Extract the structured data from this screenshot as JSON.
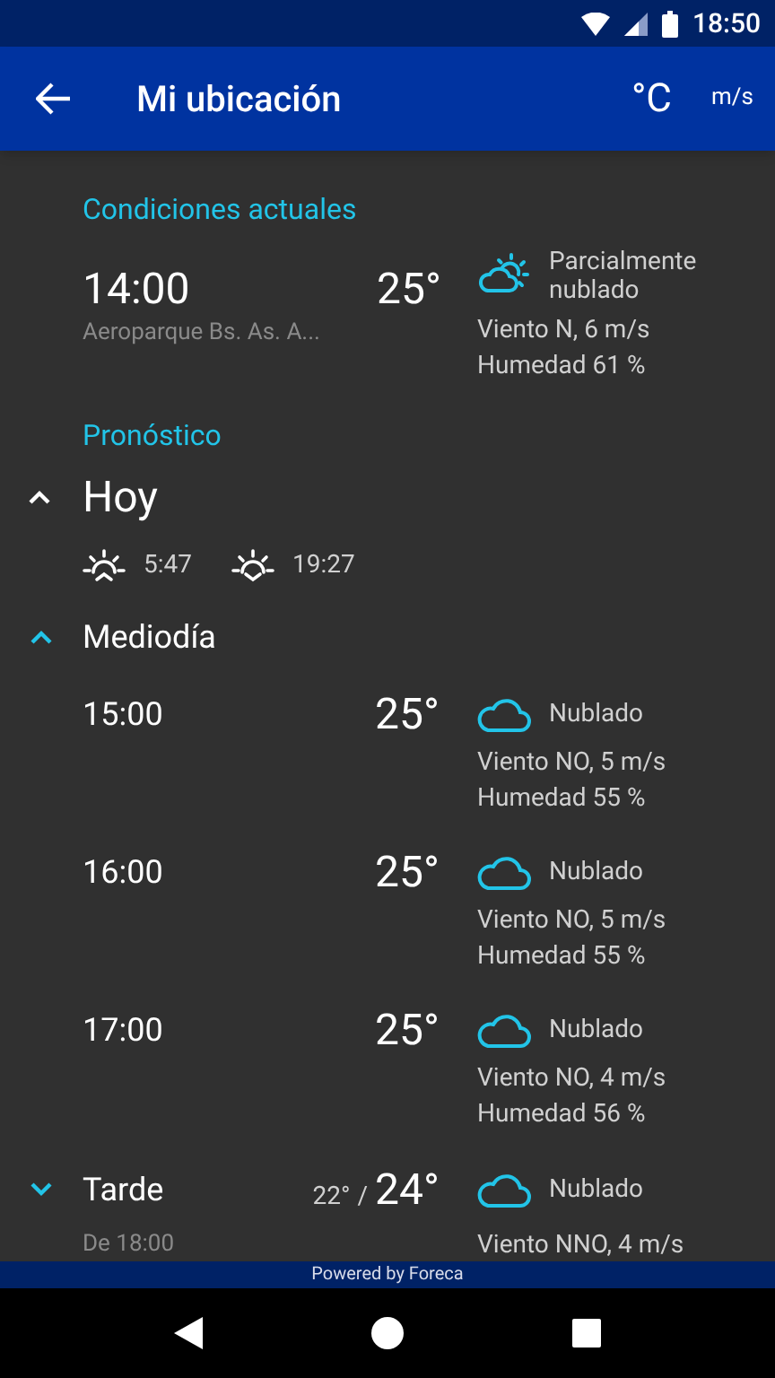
{
  "status_bar": {
    "time": "18:50"
  },
  "app_bar": {
    "title": "Mi ubicación",
    "temp_unit": "°C",
    "wind_unit": "m/s"
  },
  "current": {
    "heading": "Condiciones actuales",
    "time": "14:00",
    "station": "Aeroparque Bs. As. A...",
    "temp": "25°",
    "condition": "Parcialmente nublado",
    "kind": "partly_cloudy",
    "wind": "Viento N, 6 m/s",
    "humidity": "Humedad 61 %"
  },
  "forecast": {
    "heading": "Pronóstico",
    "day": {
      "label": "Hoy",
      "expanded": true,
      "sunrise": "5:47",
      "sunset": "19:27"
    },
    "periods": [
      {
        "label": "Mediodía",
        "expanded": true,
        "hours": [
          {
            "time": "15:00",
            "temp": "25°",
            "kind": "cloudy",
            "condition": "Nublado",
            "wind": "Viento NO, 5 m/s",
            "humidity": "Humedad 55 %"
          },
          {
            "time": "16:00",
            "temp": "25°",
            "kind": "cloudy",
            "condition": "Nublado",
            "wind": "Viento NO, 5 m/s",
            "humidity": "Humedad 55 %"
          },
          {
            "time": "17:00",
            "temp": "25°",
            "kind": "cloudy",
            "condition": "Nublado",
            "wind": "Viento NO, 4 m/s",
            "humidity": "Humedad 56 %"
          }
        ]
      },
      {
        "label": "Tarde",
        "expanded": false,
        "subtitle": "De 18:00",
        "temp_min": "22°",
        "separator": "/",
        "temp_max": "24°",
        "kind": "cloudy",
        "condition": "Nublado",
        "wind": "Viento NNO, 4 m/s"
      }
    ]
  },
  "footer": "Powered by Foreca"
}
